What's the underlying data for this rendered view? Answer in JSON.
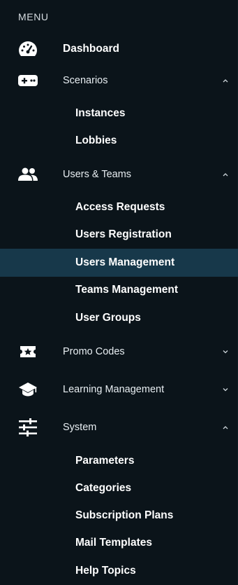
{
  "menu": {
    "header": "MENU",
    "dashboard": {
      "label": "Dashboard",
      "icon": "speedometer-icon"
    },
    "scenarios": {
      "label": "Scenarios",
      "icon": "gamepad-icon",
      "expanded": true,
      "children": [
        "Instances",
        "Lobbies"
      ]
    },
    "users_teams": {
      "label": "Users & Teams",
      "icon": "users-icon",
      "expanded": true,
      "children": [
        "Access Requests",
        "Users Registration",
        "Users Management",
        "Teams Management",
        "User Groups"
      ],
      "active_child": "Users Management"
    },
    "promo_codes": {
      "label": "Promo Codes",
      "icon": "ticket-star-icon",
      "expanded": false
    },
    "learning_management": {
      "label": "Learning Management",
      "icon": "graduation-cap-icon",
      "expanded": false
    },
    "system": {
      "label": "System",
      "icon": "sliders-icon",
      "expanded": true,
      "children": [
        "Parameters",
        "Categories",
        "Subscription Plans",
        "Mail Templates",
        "Help Topics"
      ]
    }
  },
  "colors": {
    "background": "#0b141a",
    "active_background": "#17384a",
    "text": "#ffffff"
  }
}
